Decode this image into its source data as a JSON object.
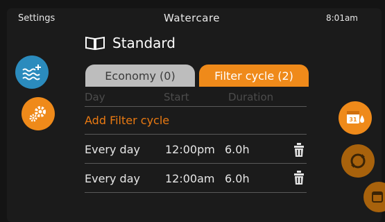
{
  "header": {
    "left_label": "Settings",
    "title": "Watercare",
    "time": "8:01am"
  },
  "mode": {
    "icon": "book-icon",
    "label": "Standard"
  },
  "tabs": [
    {
      "label": "Economy (0)",
      "active": false
    },
    {
      "label": "Filter cycle (2)",
      "active": true
    }
  ],
  "table": {
    "columns": [
      "Day",
      "Start",
      "Duration"
    ],
    "add_label": "Add Filter cycle",
    "rows": [
      {
        "day": "Every day",
        "start": "12:00pm",
        "duration": "6.0h"
      },
      {
        "day": "Every day",
        "start": "12:00am",
        "duration": "6.0h"
      }
    ]
  },
  "left_buttons": [
    {
      "icon": "water-waves-icon",
      "color": "#2b8bbd"
    },
    {
      "icon": "gears-icon",
      "color": "#ef8a1a"
    }
  ],
  "right_buttons": [
    {
      "icon": "calendar-drop-icon",
      "color": "#ef8a1a"
    },
    {
      "icon": "cycle-icon",
      "color": "#a8620c"
    },
    {
      "icon": "calendar-icon",
      "color": "#a8620c"
    }
  ],
  "colors": {
    "accent": "#ef8a1a",
    "inactive_tab": "#bdbdbd",
    "background": "#1b1b1b"
  }
}
